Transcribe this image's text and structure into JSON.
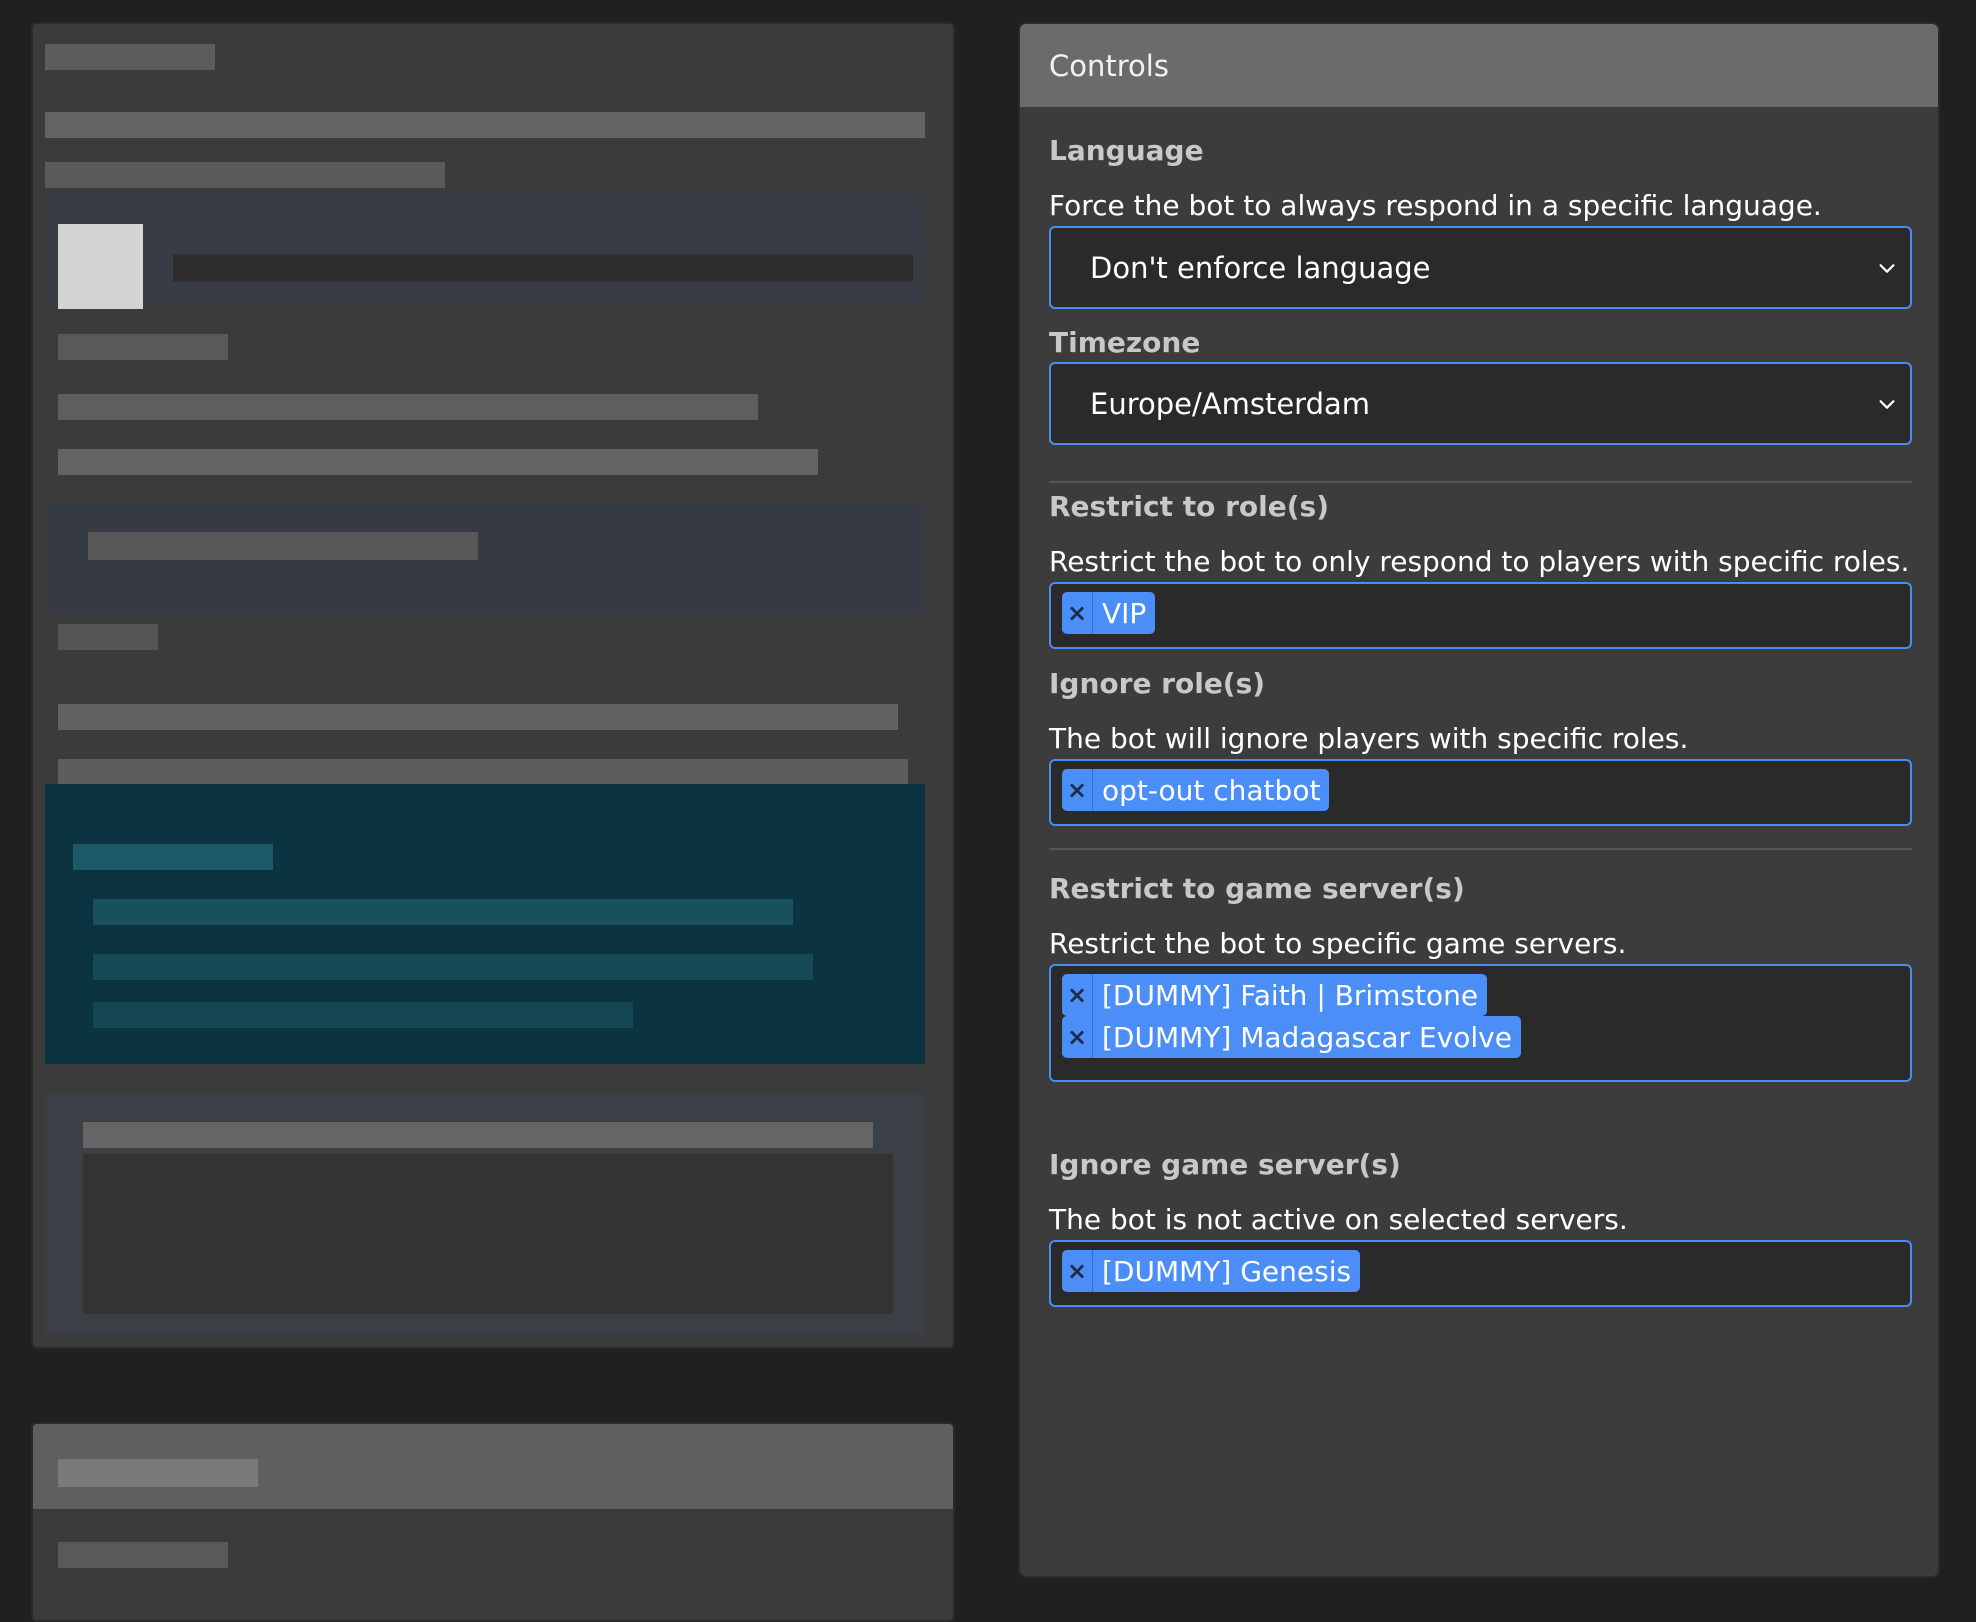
{
  "panel": {
    "title": "Controls"
  },
  "language": {
    "label": "Language",
    "description": "Force the bot to always respond in a specific language.",
    "selected": "Don't enforce language"
  },
  "timezone": {
    "label": "Timezone",
    "selected": "Europe/Amsterdam"
  },
  "restrict_roles": {
    "label": "Restrict to role(s)",
    "description": "Restrict the bot to only respond to players with specific roles.",
    "tags": [
      "VIP"
    ]
  },
  "ignore_roles": {
    "label": "Ignore role(s)",
    "description": "The bot will ignore players with specific roles.",
    "tags": [
      "opt-out chatbot"
    ]
  },
  "restrict_servers": {
    "label": "Restrict to game server(s)",
    "description": "Restrict the bot to specific game servers.",
    "tags": [
      "[DUMMY] Faith | Brimstone",
      "[DUMMY] Madagascar Evolve"
    ]
  },
  "ignore_servers": {
    "label": "Ignore game server(s)",
    "description": "The bot is not active on selected servers.",
    "tags": [
      "[DUMMY] Genesis"
    ]
  },
  "tag_remove_glyph": "×",
  "icons": {
    "select_chevron": "chevron-down-icon",
    "tag_remove": "close-icon"
  },
  "colors": {
    "accent": "#4a8df0",
    "tag": "#4b8ef7",
    "panel_header": "#6b6b6b",
    "background": "#202020"
  }
}
